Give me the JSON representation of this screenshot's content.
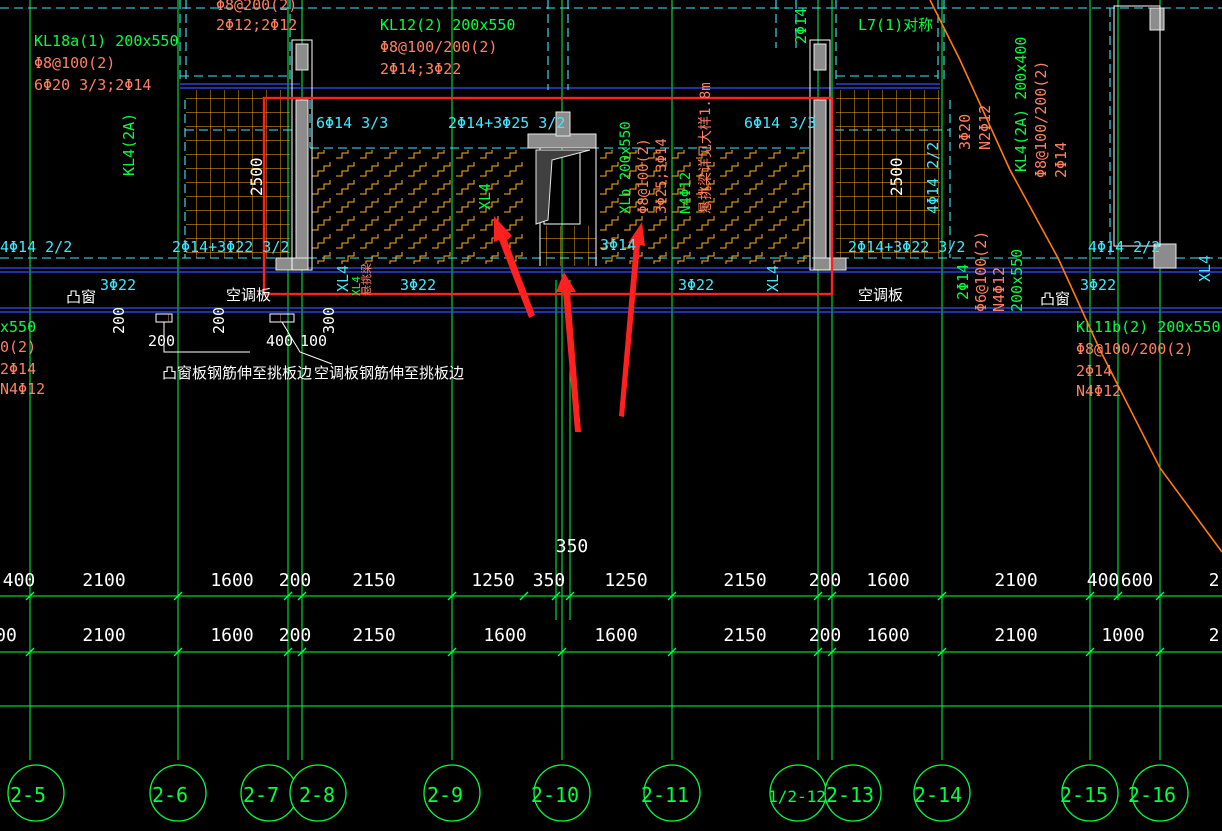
{
  "colors": {
    "background": "#000000",
    "axis_line": "#00ff40",
    "beam_outline": "#40e8ff",
    "hatch": "#ffb020",
    "annotation_red": "#ff3030",
    "text_green": "#00ff40",
    "text_red": "#ff8060",
    "text_cyan": "#40e8ff",
    "text_white": "#ffffff",
    "cut_line": "#ff7a10"
  },
  "beam_labels": {
    "kl18": [
      "KL18a(1) 200x550",
      "Φ8@100(2)",
      "6Φ20 3/3;2Φ14"
    ],
    "kl12": [
      "KL12(2) 200x550",
      "Φ8@100/200(2)",
      "2Φ14;3Φ22"
    ],
    "top_left_frag": [
      "Φ8@200(2)",
      "2Φ12;2Φ12"
    ],
    "kl4_right": [
      "KL4(2A) 200x400",
      "Φ8@100/200(2)",
      "2Φ14"
    ],
    "l7": "L7(1)对称",
    "kl11b": [
      "KL11b(2) 200x550",
      "Φ8@100/200(2)",
      "2Φ14",
      "N4Φ12"
    ],
    "left_frag": [
      "x550",
      "0(2)",
      "2Φ14",
      "N4Φ12"
    ],
    "n2": [
      "3Φ20",
      "N2Φ12"
    ],
    "xl4_right_lines": [
      "2Φ14",
      "Φ6@100(2)",
      "N4Φ12",
      "200x550"
    ],
    "kl4_left": "KL4(2A)",
    "two_phi14_top": "2Φ14"
  },
  "rebar": {
    "left_top": "6Φ14 3/3",
    "center_top": "2Φ14+3Φ25 3/2",
    "right_top": "6Φ14 3/3",
    "left_bottom": "2Φ14+3Φ22 3/2",
    "right_bottom": "2Φ14+3Φ22 3/2",
    "far_left": "4Φ14 2/2",
    "far_right": "4Φ14 2/2",
    "vertical_right": "4Φ14 2/2",
    "mid_bottom": "3Φ14",
    "beam_3phi22_a": "3Φ22",
    "beam_3phi22_b": "3Φ22",
    "beam_3phi22_c": "3Φ22",
    "beam_3phi22_d": "3Φ22",
    "beam_3phi22_e": "3Φ22",
    "xl4_1": "XL4",
    "xl4_2": "XL4",
    "xl4_3": "XL4",
    "xl_center": "XL4",
    "xlb_center": [
      "XLb 200x550",
      "Φ8@100(2)",
      "3Φ25;3Φ14",
      "N4Φ12",
      "悬挑梁详见大样1.8m"
    ]
  },
  "rooms": {
    "bay_window_left": "凸窗",
    "ac_board_left": "空调板",
    "ac_board_right": "空调板",
    "bay_window_right": "凸窗",
    "xl_small": "XL4",
    "suspend_note": "悬挑梁"
  },
  "heights": {
    "h2500_left": "2500",
    "h2500_right": "2500"
  },
  "notes": {
    "bay_window_note": "凸窗板钢筋伸至挑板边",
    "ac_note": "空调板钢筋伸至挑板边"
  },
  "small_dims": {
    "d200_a": "200",
    "d200_b": "200",
    "d200_c": "200",
    "d400": "400",
    "d100": "100",
    "d300": "300",
    "d350": "350"
  },
  "dims_row1": [
    "400",
    "2100",
    "1600",
    "200",
    "2150",
    "1250",
    "350",
    "1250",
    "2150",
    "200",
    "1600",
    "2100",
    "400",
    "600",
    "2"
  ],
  "dims_row2": [
    "00",
    "2100",
    "1600",
    "200",
    "2150",
    "1600",
    "1600",
    "2150",
    "200",
    "1600",
    "2100",
    "1000",
    "2"
  ],
  "axes": [
    "2-5",
    "2-6",
    "2-7",
    "2-8",
    "2-9",
    "2-10",
    "2-11",
    "1/2-12",
    "2-13",
    "2-14",
    "2-15",
    "2-16"
  ]
}
